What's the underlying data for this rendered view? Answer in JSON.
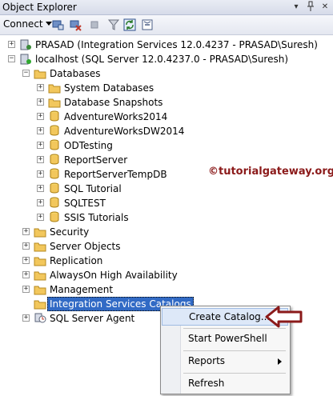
{
  "panel": {
    "title": "Object Explorer"
  },
  "toolbar": {
    "connect_label": "Connect",
    "icons": [
      "connect-object-icon",
      "disconnect-icon",
      "stop-icon",
      "filter-icon",
      "refresh-icon",
      "collapse-icon"
    ]
  },
  "tree": {
    "prasad": "PRASAD (Integration Services 12.0.4237 - PRASAD\\Suresh)",
    "localhost": "localhost (SQL Server 12.0.4237.0 - PRASAD\\Suresh)",
    "databases": "Databases",
    "db_children": [
      "System Databases",
      "Database Snapshots",
      "AdventureWorks2014",
      "AdventureWorksDW2014",
      "ODTesting",
      "ReportServer",
      "ReportServerTempDB",
      "SQL Tutorial",
      "SQLTEST",
      "SSIS Tutorials"
    ],
    "security": "Security",
    "server_objects": "Server Objects",
    "replication": "Replication",
    "alwayson": "AlwaysOn High Availability",
    "management": "Management",
    "is_catalogs": "Integration Services Catalogs",
    "agent": "SQL Server Agent"
  },
  "context_menu": {
    "items": [
      "Create Catalog...",
      "Start PowerShell",
      "Reports",
      "Refresh"
    ]
  },
  "watermark": "©tutorialgateway.org",
  "colors": {
    "selection": "#316ac5",
    "arrow": "#8b1a1a",
    "folder": "#f2c75c"
  }
}
